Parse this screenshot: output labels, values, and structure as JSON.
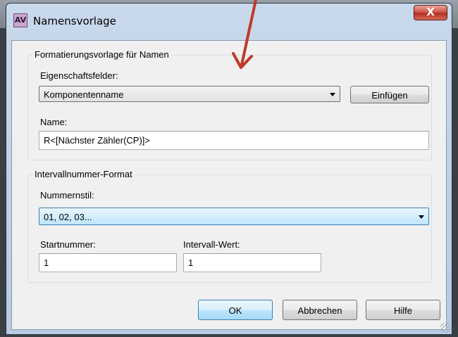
{
  "window": {
    "title": "Namensvorlage",
    "close_label": "X",
    "icon_label": "AV"
  },
  "name_format": {
    "group_title": "Formatierungsvorlage für Namen",
    "property_fields_label": "Eigenschaftsfelder:",
    "property_fields_value": "Komponentenname",
    "insert_label": "Einfügen",
    "name_label": "Name:",
    "name_value": "R<[Nächster Zähler(CP)]>"
  },
  "interval_format": {
    "group_title": "Intervallnummer-Format",
    "number_style_label": "Nummernstil:",
    "number_style_value": "01, 02, 03...",
    "start_number_label": "Startnummer:",
    "start_number_value": "1",
    "interval_value_label": "Intervall-Wert:",
    "interval_value_value": "1"
  },
  "buttons": {
    "ok": "OK",
    "cancel": "Abbrechen",
    "help": "Hilfe"
  },
  "colors": {
    "annotation_arrow": "#c0392b",
    "focus_border": "#3c7fb1"
  }
}
